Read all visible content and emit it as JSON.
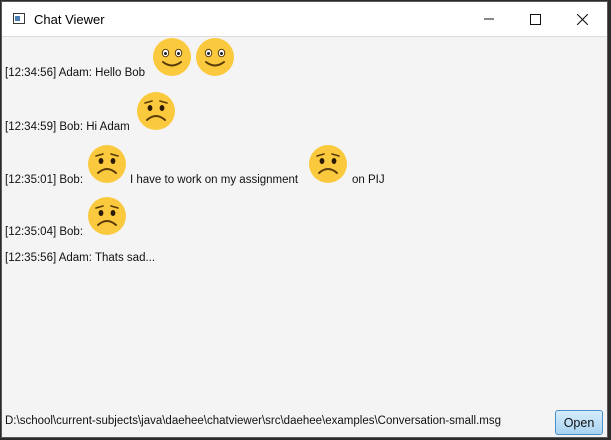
{
  "window": {
    "title": "Chat Viewer"
  },
  "messages": [
    {
      "time": "[12:34:56]",
      "sender": "Adam:",
      "text": "Hello Bob"
    },
    {
      "time": "[12:34:59]",
      "sender": "Bob:",
      "text": "Hi Adam"
    },
    {
      "time": "[12:35:01]",
      "sender": "Bob:",
      "text_1": "I have to work on my assignment",
      "text_2": "on PIJ"
    },
    {
      "time": "[12:35:04]",
      "sender": "Bob:"
    },
    {
      "time": "[12:35:56]",
      "sender": "Adam:",
      "text": "Thats sad..."
    }
  ],
  "emoji": {
    "happy": "happy-face-icon",
    "sad": "sad-face-icon",
    "color": "#fbc93d"
  },
  "footer": {
    "path": "D:\\school\\current-subjects\\java\\daehee\\chatviewer\\src\\daehee\\examples\\Conversation-small.msg",
    "open_label": "Open"
  },
  "colors": {
    "button_border": "#4a90c8",
    "background": "#f4f4f4"
  }
}
